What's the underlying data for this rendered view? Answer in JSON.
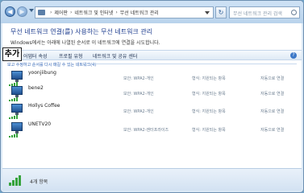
{
  "address": {
    "crumbs": [
      "제어판",
      "네트워크 및 인터넷",
      "무선 네트워크 관리"
    ]
  },
  "search": {
    "placeholder": "무선 네트워크 관리 검색"
  },
  "page": {
    "title": "무선 네트워크 연결(를) 사용하는 무선 네트워크 관리",
    "description": "Windows에서는 아래에 나열된 순서로 이 네트워크에 연결을 시도합니다."
  },
  "toolbar": {
    "add_label": "추가",
    "items": [
      "어댑터 속성",
      "프로필 유형",
      "네트워크 및 공유 센터"
    ]
  },
  "group_header": "보고 수정하고 순서를 다시 매길 수 있는 네트워크(4)",
  "networks": [
    {
      "name": "yoonjiibung",
      "security": "보안: WPA2-개인",
      "type": "형식: 지원되는 항목",
      "connect": "자동으로 연결"
    },
    {
      "name": "bene2",
      "security": "보안: WPA2-개인",
      "type": "형식: 지원되는 항목",
      "connect": "자동으로 연결"
    },
    {
      "name": "Hollys Coffee",
      "security": "보안: WPA2-개인",
      "type": "형식: 지원되는 항목",
      "connect": "자동으로 연결"
    },
    {
      "name": "UNETV20",
      "security": "보안: WPA2-엔터프라이즈",
      "type": "형식: 지원되는 항목",
      "connect": "자동으로 연결"
    }
  ],
  "status": {
    "count_text": "4개 항목"
  },
  "icons": {
    "back": "back-arrow-icon",
    "forward": "forward-arrow-icon",
    "folder": "control-panel-icon",
    "refresh": "refresh-icon",
    "search": "search-icon",
    "help": "help-icon",
    "network": "wireless-network-icon"
  },
  "colors": {
    "title": "#1e3d8f",
    "accent": "#2f63b5",
    "signal": "#36a33c"
  }
}
